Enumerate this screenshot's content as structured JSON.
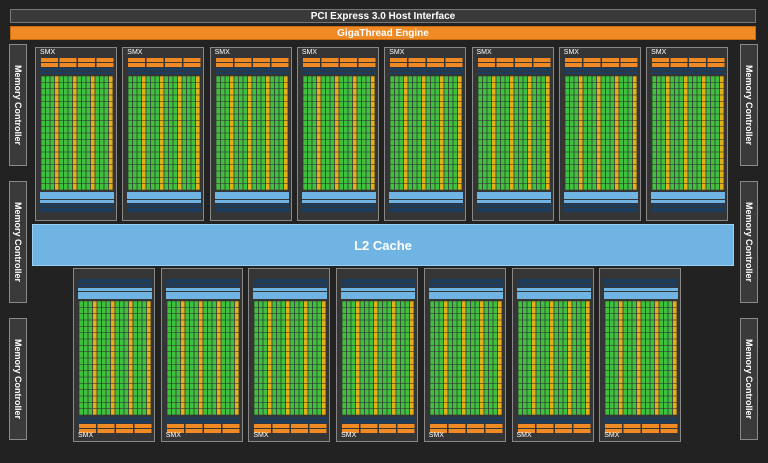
{
  "pcie": {
    "label": "PCI Express 3.0 Host Interface"
  },
  "giga": {
    "label": "GigaThread Engine"
  },
  "memory_controller_label": "Memory Controller",
  "l2": {
    "label": "L2 Cache"
  },
  "smx_label": "SMX",
  "colors": {
    "core": "#3ec23e",
    "special_unit": "#e4b01a",
    "cache": "#6fb4e3",
    "scheduler": "#f08a24",
    "register": "#1c3d5e",
    "background": "#222222"
  },
  "counts": {
    "top_smx": 8,
    "bottom_smx": 7,
    "memory_controllers_per_side": 3
  }
}
